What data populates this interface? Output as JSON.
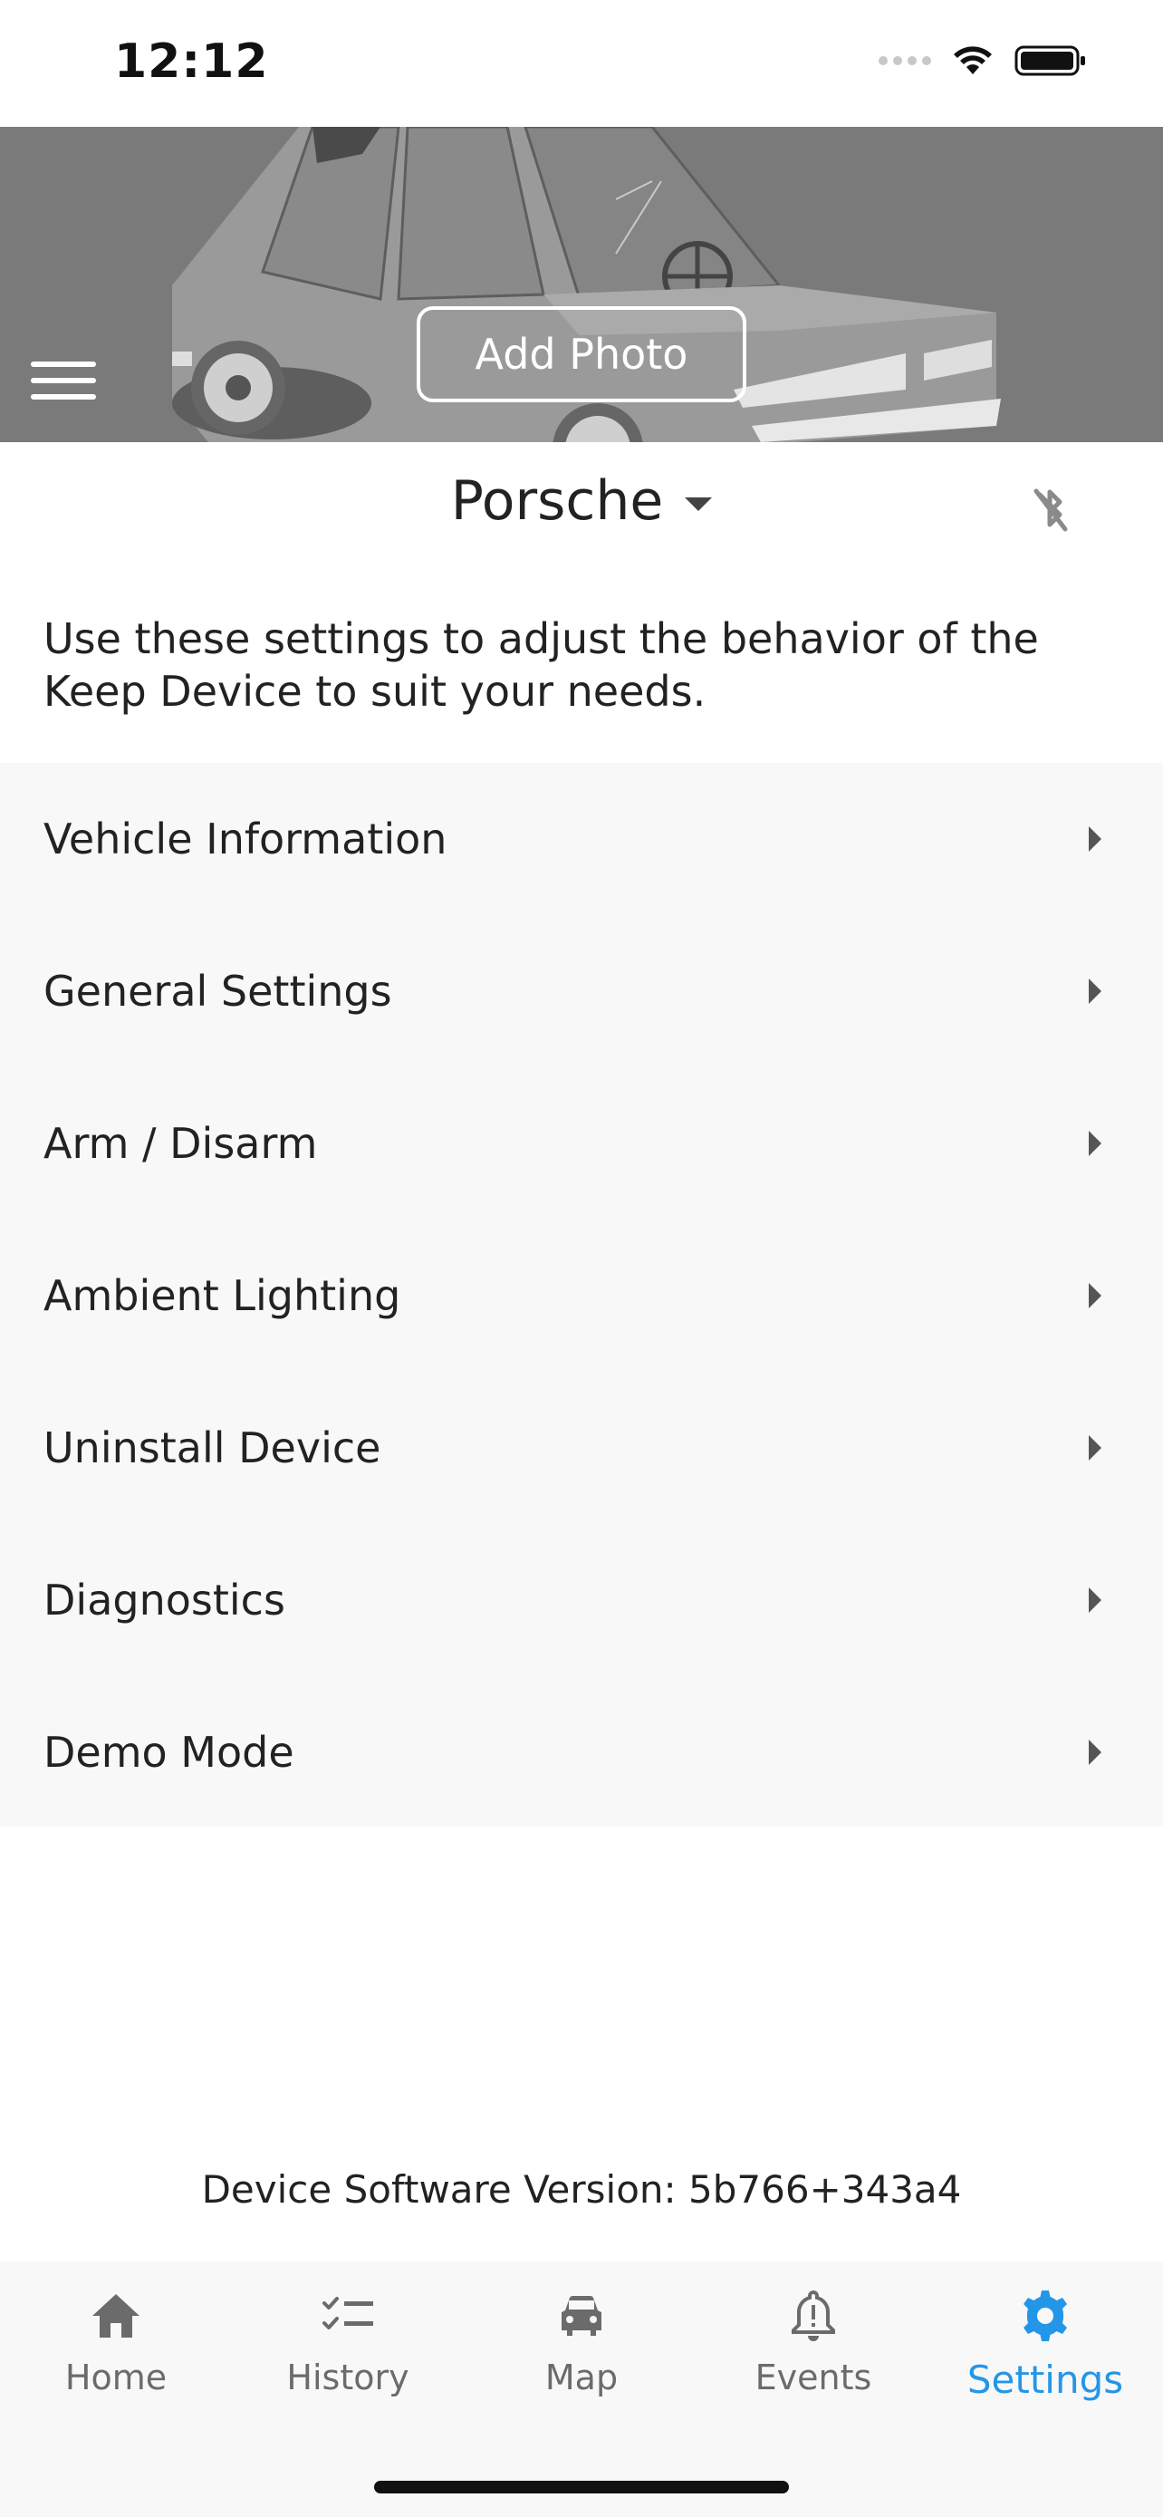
{
  "status_bar": {
    "time": "12:12"
  },
  "header": {
    "add_photo_label": "Add Photo"
  },
  "vehicle": {
    "name": "Porsche"
  },
  "description": "Use these settings to adjust the behavior of the Keep Device to suit your needs.",
  "settings": {
    "items": [
      {
        "label": "Vehicle Information"
      },
      {
        "label": "General Settings"
      },
      {
        "label": "Arm / Disarm"
      },
      {
        "label": "Ambient Lighting"
      },
      {
        "label": "Uninstall Device"
      },
      {
        "label": "Diagnostics"
      },
      {
        "label": "Demo Mode"
      }
    ]
  },
  "version_text": "Device Software Version: 5b766+343a4",
  "bottom_nav": {
    "items": [
      {
        "label": "Home",
        "icon": "home-icon",
        "active": false
      },
      {
        "label": "History",
        "icon": "history-icon",
        "active": false
      },
      {
        "label": "Map",
        "icon": "car-icon",
        "active": false
      },
      {
        "label": "Events",
        "icon": "bell-alert-icon",
        "active": false
      },
      {
        "label": "Settings",
        "icon": "gear-icon",
        "active": true
      }
    ]
  },
  "colors": {
    "accent": "#2496e8",
    "inactive_nav": "#6b6b6b",
    "header_bg": "#7a7a7a",
    "list_bg": "#f8f8f8"
  }
}
